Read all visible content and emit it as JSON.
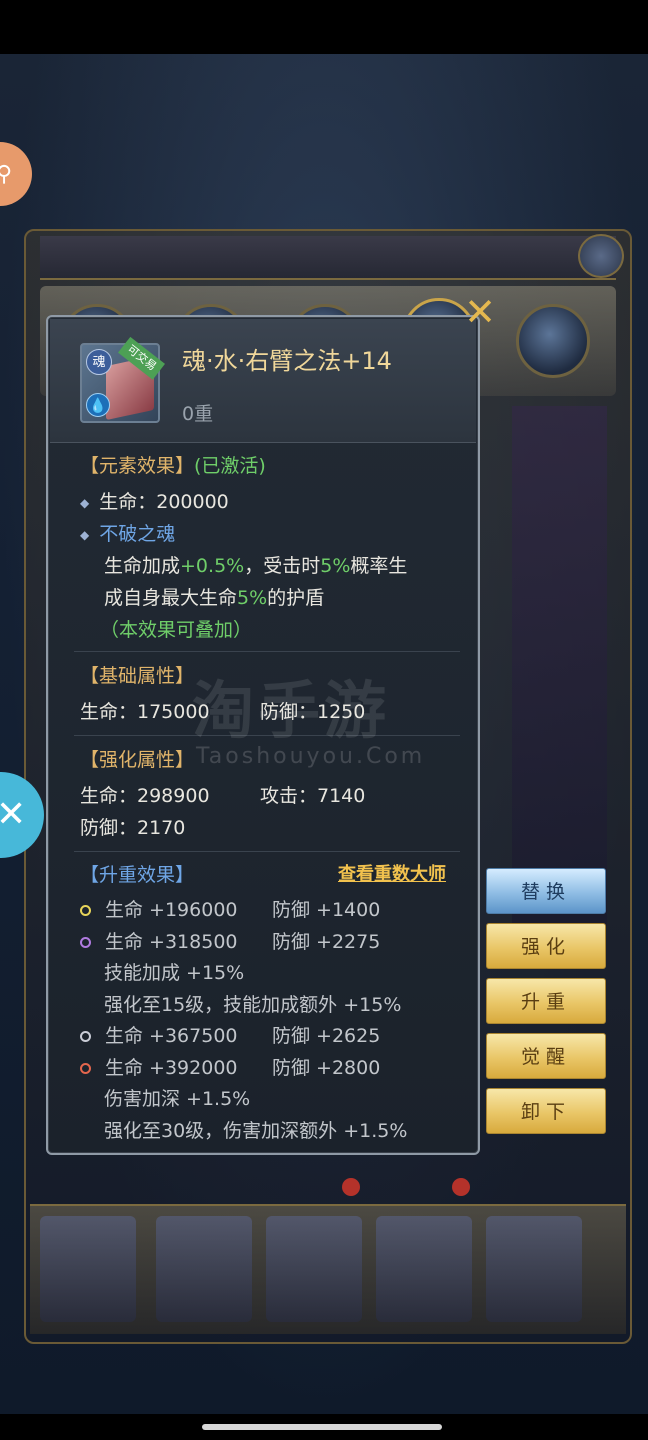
{
  "item": {
    "name": "魂·水·右臂之法+14",
    "tier": "0重",
    "icon_tag": "可交易",
    "soul_badge": "魂",
    "icon": "water-soul-book-icon"
  },
  "element_effect": {
    "title": "【元素效果】",
    "status": "(已激活)",
    "hp_line": "生命：200000",
    "soul_name": "不破之魂",
    "desc_1a": "生命加成",
    "desc_1b": "+0.5%",
    "desc_1c": "，受击时",
    "desc_1d": "5%",
    "desc_1e": "概率生",
    "desc_2a": "成自身最大生命",
    "desc_2b": "5%",
    "desc_2c": "的护盾",
    "stack_note": "（本效果可叠加）"
  },
  "base_attr": {
    "title": "【基础属性】",
    "hp": "生命：175000",
    "def": "防御：1250"
  },
  "enhance_attr": {
    "title": "【强化属性】",
    "hp": "生命：298900",
    "atk": "攻击：7140",
    "def": "防御：2170"
  },
  "upgrade_effect": {
    "title": "【升重效果】",
    "link": "查看重数大师",
    "rows": [
      {
        "hp": "生命 +196000",
        "def": "防御 +1400",
        "color": "#e8d55a"
      },
      {
        "hp": "生命 +318500",
        "def": "防御 +2275",
        "color": "#b07be0"
      },
      {
        "extra": "技能加成 +15%"
      },
      {
        "extra": "强化至15级，技能加成额外 +15%"
      },
      {
        "hp": "生命 +367500",
        "def": "防御 +2625",
        "color": "#c9ccd6"
      },
      {
        "hp": "生命 +392000",
        "def": "防御 +2800",
        "color": "#e4664d"
      },
      {
        "extra": "伤害加深 +1.5%"
      },
      {
        "extra": "强化至30级，伤害加深额外 +1.5%"
      }
    ]
  },
  "actions": {
    "replace": "替换",
    "enhance": "强化",
    "upgrade": "升重",
    "awaken": "觉醒",
    "unequip": "卸下"
  },
  "watermark": {
    "main": "淘手游",
    "sub": "Taoshouyou.Com"
  },
  "colors": {
    "gold_title": "#e0b46a",
    "green": "#6fce69",
    "blue": "#6fa6e6",
    "link": "#f2c24e"
  }
}
